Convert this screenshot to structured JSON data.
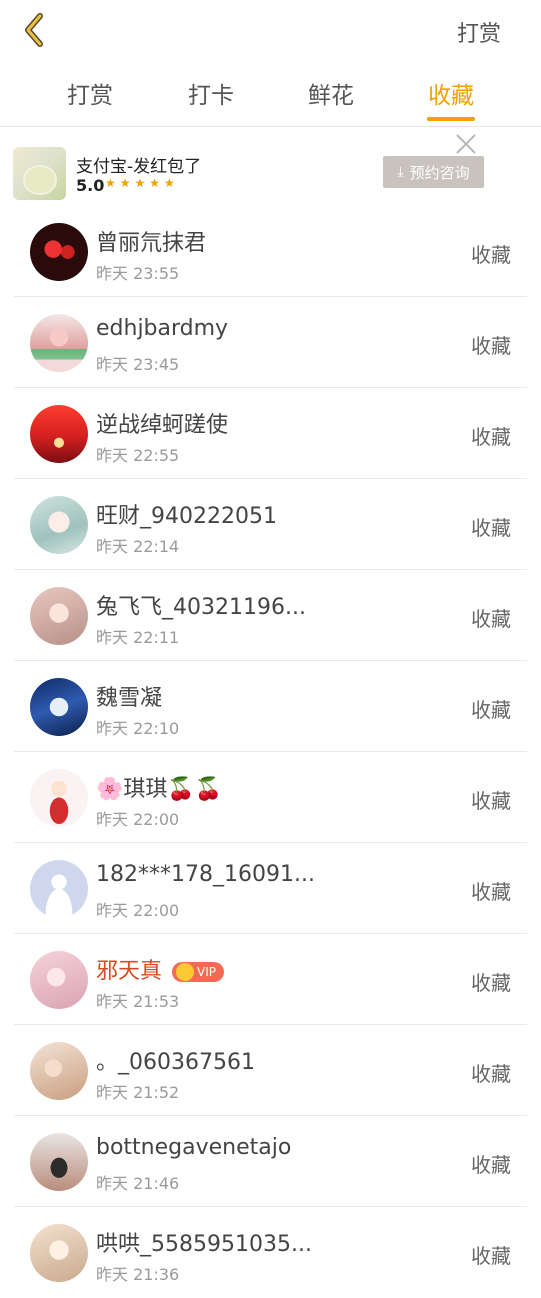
{
  "header": {
    "right_label": "打赏"
  },
  "tabs": [
    {
      "label": "打赏",
      "active": false
    },
    {
      "label": "打卡",
      "active": false
    },
    {
      "label": "鲜花",
      "active": false
    },
    {
      "label": "收藏",
      "active": true
    }
  ],
  "ad": {
    "title": "支付宝-发红包了",
    "rating": "5.0",
    "stars": "★★★★★",
    "button_label": "预约咨询"
  },
  "list": [
    {
      "name": "曾丽氘抹君",
      "time": "昨天 23:55",
      "action": "收藏",
      "avatar": "av1",
      "vip": false
    },
    {
      "name": "edhjbardmy",
      "time": "昨天 23:45",
      "action": "收藏",
      "avatar": "av2",
      "vip": false
    },
    {
      "name": "逆战绰蚵蹉使",
      "time": "昨天 22:55",
      "action": "收藏",
      "avatar": "av3",
      "vip": false
    },
    {
      "name": "旺财_940222051",
      "time": "昨天 22:14",
      "action": "收藏",
      "avatar": "av4",
      "vip": false
    },
    {
      "name": "兔飞飞_40321196...",
      "time": "昨天 22:11",
      "action": "收藏",
      "avatar": "av5",
      "vip": false
    },
    {
      "name": "魏雪凝",
      "time": "昨天 22:10",
      "action": "收藏",
      "avatar": "av6",
      "vip": false
    },
    {
      "name": "🌸琪琪🍒🍒",
      "time": "昨天 22:00",
      "action": "收藏",
      "avatar": "av7",
      "vip": false
    },
    {
      "name": "182***178_16091...",
      "time": "昨天 22:00",
      "action": "收藏",
      "avatar": "av8",
      "vip": false
    },
    {
      "name": "邪天真",
      "time": "昨天 21:53",
      "action": "收藏",
      "avatar": "av9",
      "vip": true,
      "badge": "VIP"
    },
    {
      "name": "。_060367561",
      "time": "昨天 21:52",
      "action": "收藏",
      "avatar": "av10",
      "vip": false
    },
    {
      "name": "bottnegavenetajo",
      "time": "昨天 21:46",
      "action": "收藏",
      "avatar": "av11",
      "vip": false
    },
    {
      "name": "哄哄_5585951035...",
      "time": "昨天 21:36",
      "action": "收藏",
      "avatar": "av12",
      "vip": false
    }
  ],
  "colors": {
    "accent": "#f0a100",
    "vip_name": "#d9491f",
    "vip_badge": "#f26a54"
  }
}
